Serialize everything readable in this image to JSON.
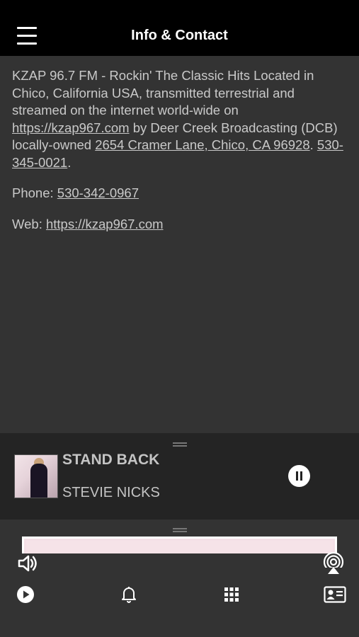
{
  "header": {
    "title": "Info & Contact",
    "menu_icon": "hamburger-menu-icon"
  },
  "info": {
    "description_prefix": "KZAP 96.7 FM - Rockin' The Classic Hits Located in Chico, California USA, transmitted terrestrial and streamed on the internet world-wide on ",
    "description_link": "https://kzap967.com",
    "description_mid": " by Deer Creek Broadcasting (DCB) locally-owned ",
    "address_link": "2654 Cramer Lane, Chico, CA 96928",
    "description_sep": ". ",
    "phone_link_inline": "530-345-0021",
    "description_end": ".",
    "phone_label": "Phone: ",
    "phone_value": "530-342-0967",
    "web_label": "Web: ",
    "web_value": "https://kzap967.com"
  },
  "now_playing": {
    "song_title": "STAND BACK",
    "artist": "STEVIE NICKS",
    "play_state_icon": "pause-icon"
  },
  "bottom_nav": {
    "icons": [
      "play-icon",
      "bell-icon",
      "grid-icon",
      "contact-card-icon"
    ],
    "volume_icon": "volume-icon",
    "airplay_icon": "airplay-icon"
  },
  "colors": {
    "background": "#333333",
    "header": "#000000",
    "now_playing_bar": "#242424",
    "text": "#c9c9c9"
  }
}
